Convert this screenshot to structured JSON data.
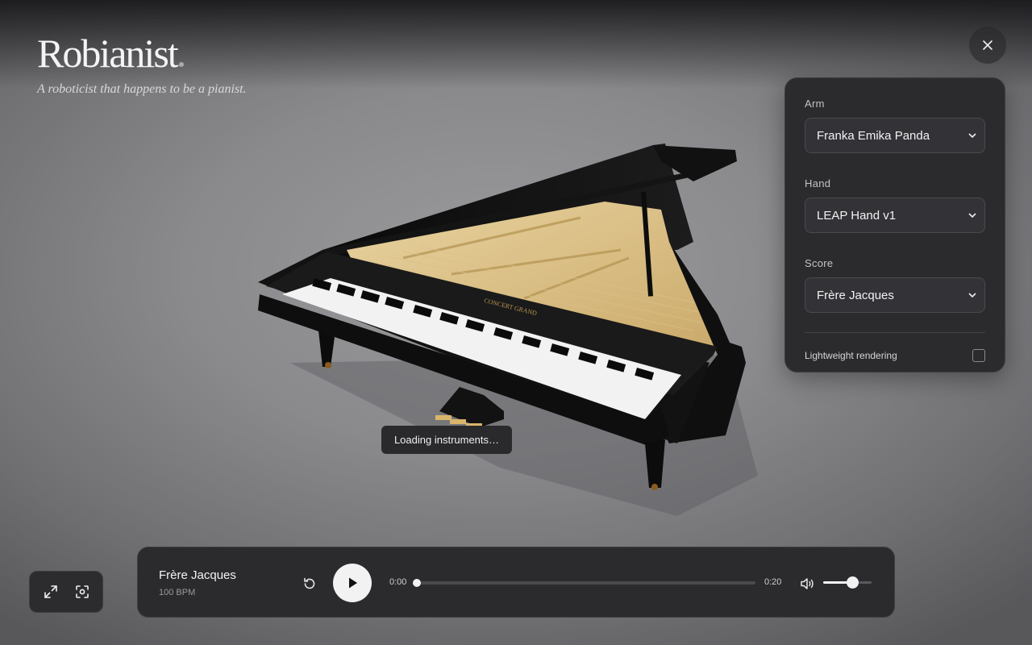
{
  "brand": {
    "title": "Robianist",
    "subtitle": "A roboticist that happens to be a pianist."
  },
  "settings": {
    "arm": {
      "label": "Arm",
      "value": "Franka Emika Panda"
    },
    "hand": {
      "label": "Hand",
      "value": "LEAP Hand v1"
    },
    "score": {
      "label": "Score",
      "value": "Frère Jacques"
    },
    "lightweight": {
      "label": "Lightweight rendering",
      "checked": false
    }
  },
  "status": {
    "loading_text": "Loading instruments…"
  },
  "player": {
    "title": "Frère Jacques",
    "tempo": "100 BPM",
    "current_time": "0:00",
    "duration": "0:20",
    "progress": 0,
    "volume": 0.6
  },
  "scene": {
    "piano_label": "CONCERT GRAND"
  }
}
